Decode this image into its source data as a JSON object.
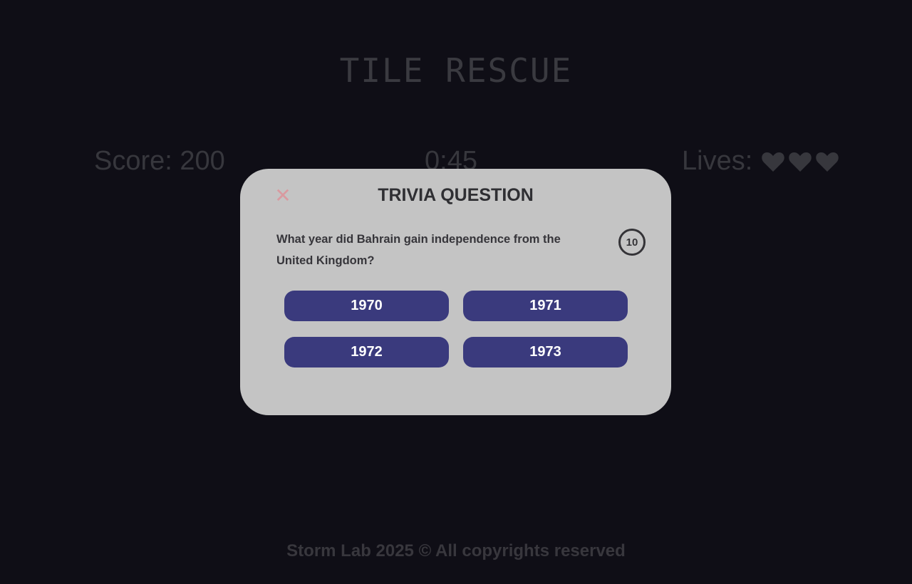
{
  "game": {
    "title": "TILE RESCUE"
  },
  "hud": {
    "score_text": "Score: 200",
    "timer_text": "0:45",
    "lives_label": "Lives:",
    "lives_count": 3
  },
  "modal": {
    "close_symbol": "✕",
    "title": "TRIVIA QUESTION",
    "question": "What year did Bahrain gain independence from the United Kingdom?",
    "countdown": "10",
    "answers": [
      "1970",
      "1971",
      "1972",
      "1973"
    ]
  },
  "footer": {
    "text": "Storm Lab 2025 © All copyrights reserved"
  },
  "colors": {
    "background": "#0f0e16",
    "modal_bg": "#c4c4c4",
    "answer_button": "#3a3a7d",
    "close_icon": "#d99aa0",
    "dimmed_text": "#37373d"
  },
  "icons": {
    "close": "close-icon",
    "life": "heart-icon"
  }
}
